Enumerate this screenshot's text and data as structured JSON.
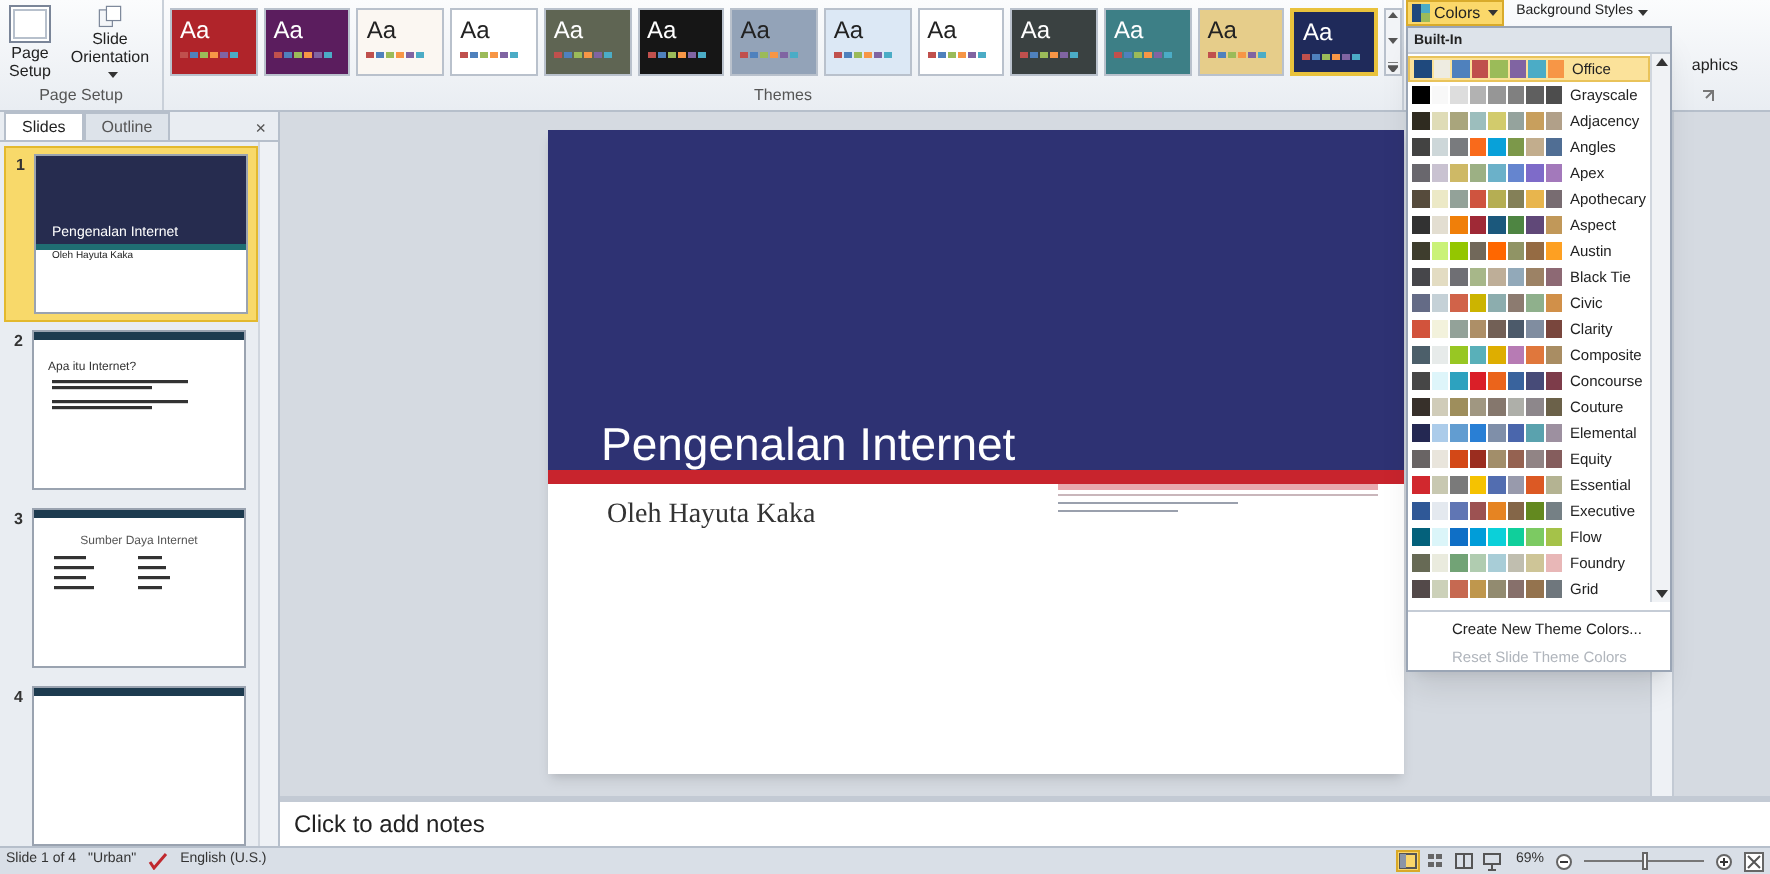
{
  "ribbon": {
    "page_setup": {
      "buttons": [
        {
          "label": "Page Setup",
          "kind": "page",
          "dropdown": false
        },
        {
          "label": "Slide Orientation",
          "kind": "orientation",
          "dropdown": true
        }
      ],
      "group_label": "Page Setup"
    },
    "themes": {
      "group_label": "Themes",
      "items": [
        {
          "text": "Aa",
          "color": "#b0242a",
          "selected": false
        },
        {
          "text": "Aa",
          "color": "#5b1d5e",
          "selected": false
        },
        {
          "text": "Aa",
          "color": "#fbf7f2",
          "selected": false
        },
        {
          "text": "Aa",
          "color": "#ffffff",
          "selected": false
        },
        {
          "text": "Aa",
          "color": "#5f6553",
          "selected": false
        },
        {
          "text": "Aa",
          "color": "#161616",
          "selected": false
        },
        {
          "text": "Aa",
          "color": "#93a3b8",
          "selected": false
        },
        {
          "text": "Aa",
          "color": "#dce8f5",
          "selected": false
        },
        {
          "text": "Aa",
          "color": "#ffffff",
          "selected": false
        },
        {
          "text": "Aa",
          "color": "#3a4141",
          "selected": false
        },
        {
          "text": "Aa",
          "color": "#3d7f86",
          "selected": false
        },
        {
          "text": "Aa",
          "color": "#e6cd8a",
          "selected": false
        },
        {
          "text": "Aa",
          "color": "#1f2a5a",
          "selected": true
        }
      ]
    },
    "colors_button": {
      "label": "Colors",
      "open": true
    },
    "background_styles": {
      "label": "Background Styles"
    },
    "hide_graphics": {
      "label": "aphics"
    }
  },
  "colors_menu": {
    "header": "Built-In",
    "schemes": [
      {
        "name": "Office",
        "selected": true,
        "swatches": [
          {
            "color": "#1f497d"
          },
          {
            "color": "#eeece1"
          },
          {
            "color": "#4f81bd"
          },
          {
            "color": "#c0504d"
          },
          {
            "color": "#9bbb59"
          },
          {
            "color": "#8064a2"
          },
          {
            "color": "#4bacc6"
          },
          {
            "color": "#f79646"
          }
        ]
      },
      {
        "name": "Grayscale",
        "selected": false,
        "swatches": [
          {
            "color": "#000000"
          },
          {
            "color": "#f8f8f8"
          },
          {
            "color": "#dddddd"
          },
          {
            "color": "#b2b2b2"
          },
          {
            "color": "#969696"
          },
          {
            "color": "#808080"
          },
          {
            "color": "#5f5f5f"
          },
          {
            "color": "#4d4d4d"
          }
        ]
      },
      {
        "name": "Adjacency",
        "selected": false,
        "swatches": [
          {
            "color": "#2f2b20"
          },
          {
            "color": "#dfdcb7"
          },
          {
            "color": "#a9a57c"
          },
          {
            "color": "#9cbebd"
          },
          {
            "color": "#d2cb6c"
          },
          {
            "color": "#95a39d"
          },
          {
            "color": "#c89f5d"
          },
          {
            "color": "#b1a089"
          }
        ]
      },
      {
        "name": "Angles",
        "selected": false,
        "swatches": [
          {
            "color": "#434342"
          },
          {
            "color": "#cdd7d9"
          },
          {
            "color": "#797b7e"
          },
          {
            "color": "#f96a1b"
          },
          {
            "color": "#08a1d9"
          },
          {
            "color": "#7c984a"
          },
          {
            "color": "#c2ad8d"
          },
          {
            "color": "#506e94"
          }
        ]
      },
      {
        "name": "Apex",
        "selected": false,
        "swatches": [
          {
            "color": "#69676d"
          },
          {
            "color": "#c9c2d1"
          },
          {
            "color": "#ceb966"
          },
          {
            "color": "#9cb084"
          },
          {
            "color": "#6bb1c9"
          },
          {
            "color": "#6585cf"
          },
          {
            "color": "#7e6bc9"
          },
          {
            "color": "#a379bb"
          }
        ]
      },
      {
        "name": "Apothecary",
        "selected": false,
        "swatches": [
          {
            "color": "#564b3c"
          },
          {
            "color": "#ece9c6"
          },
          {
            "color": "#93a299"
          },
          {
            "color": "#cf543f"
          },
          {
            "color": "#b5ae53"
          },
          {
            "color": "#848058"
          },
          {
            "color": "#e8b54d"
          },
          {
            "color": "#786c71"
          }
        ]
      },
      {
        "name": "Aspect",
        "selected": false,
        "swatches": [
          {
            "color": "#323232"
          },
          {
            "color": "#e3ded1"
          },
          {
            "color": "#f07f09"
          },
          {
            "color": "#9f2936"
          },
          {
            "color": "#1b587c"
          },
          {
            "color": "#4e8542"
          },
          {
            "color": "#604878"
          },
          {
            "color": "#c19859"
          }
        ]
      },
      {
        "name": "Austin",
        "selected": false,
        "swatches": [
          {
            "color": "#3e3d2d"
          },
          {
            "color": "#caf278"
          },
          {
            "color": "#94c600"
          },
          {
            "color": "#71685a"
          },
          {
            "color": "#ff6700"
          },
          {
            "color": "#909465"
          },
          {
            "color": "#956b43"
          },
          {
            "color": "#fea022"
          }
        ]
      },
      {
        "name": "Black Tie",
        "selected": false,
        "swatches": [
          {
            "color": "#46464a"
          },
          {
            "color": "#e3dcc2"
          },
          {
            "color": "#6f6f74"
          },
          {
            "color": "#a7b789"
          },
          {
            "color": "#beae98"
          },
          {
            "color": "#92a9b9"
          },
          {
            "color": "#9c8265"
          },
          {
            "color": "#8d6974"
          }
        ]
      },
      {
        "name": "Civic",
        "selected": false,
        "swatches": [
          {
            "color": "#646b86"
          },
          {
            "color": "#c5d1d7"
          },
          {
            "color": "#d16349"
          },
          {
            "color": "#ccb400"
          },
          {
            "color": "#8cadae"
          },
          {
            "color": "#8c7b70"
          },
          {
            "color": "#8fb08c"
          },
          {
            "color": "#d19049"
          }
        ]
      },
      {
        "name": "Clarity",
        "selected": false,
        "swatches": [
          {
            "color": "#d2533c"
          },
          {
            "color": "#f3f2dc"
          },
          {
            "color": "#93a299"
          },
          {
            "color": "#ad8f67"
          },
          {
            "color": "#726056"
          },
          {
            "color": "#4c5a6a"
          },
          {
            "color": "#808da0"
          },
          {
            "color": "#79463d"
          }
        ]
      },
      {
        "name": "Composite",
        "selected": false,
        "swatches": [
          {
            "color": "#4c5f6a"
          },
          {
            "color": "#e7ebea"
          },
          {
            "color": "#98c723"
          },
          {
            "color": "#59b0b9"
          },
          {
            "color": "#deae00"
          },
          {
            "color": "#b77bb4"
          },
          {
            "color": "#e0773c"
          },
          {
            "color": "#a98d63"
          }
        ]
      },
      {
        "name": "Concourse",
        "selected": false,
        "swatches": [
          {
            "color": "#464646"
          },
          {
            "color": "#def5fa"
          },
          {
            "color": "#2da2bf"
          },
          {
            "color": "#da1f28"
          },
          {
            "color": "#eb641b"
          },
          {
            "color": "#39639d"
          },
          {
            "color": "#474b78"
          },
          {
            "color": "#7d3c4a"
          }
        ]
      },
      {
        "name": "Couture",
        "selected": false,
        "swatches": [
          {
            "color": "#37302a"
          },
          {
            "color": "#d0ccb9"
          },
          {
            "color": "#9e8e5c"
          },
          {
            "color": "#a09781"
          },
          {
            "color": "#85776d"
          },
          {
            "color": "#aeafa9"
          },
          {
            "color": "#8d878b"
          },
          {
            "color": "#6b6149"
          }
        ]
      },
      {
        "name": "Elemental",
        "selected": false,
        "swatches": [
          {
            "color": "#242852"
          },
          {
            "color": "#acccea"
          },
          {
            "color": "#629dd1"
          },
          {
            "color": "#297fd5"
          },
          {
            "color": "#7f8fa9"
          },
          {
            "color": "#4a66ac"
          },
          {
            "color": "#5aa2ae"
          },
          {
            "color": "#9d90a0"
          }
        ]
      },
      {
        "name": "Equity",
        "selected": false,
        "swatches": [
          {
            "color": "#696464"
          },
          {
            "color": "#e9e5dc"
          },
          {
            "color": "#d34817"
          },
          {
            "color": "#9b2d1f"
          },
          {
            "color": "#a28e6a"
          },
          {
            "color": "#956251"
          },
          {
            "color": "#918485"
          },
          {
            "color": "#855d5d"
          }
        ]
      },
      {
        "name": "Essential",
        "selected": false,
        "swatches": [
          {
            "color": "#d1282e"
          },
          {
            "color": "#c8c8b1"
          },
          {
            "color": "#7a7a7a"
          },
          {
            "color": "#f5c201"
          },
          {
            "color": "#526db0"
          },
          {
            "color": "#989aac"
          },
          {
            "color": "#dc5924"
          },
          {
            "color": "#b4b392"
          }
        ]
      },
      {
        "name": "Executive",
        "selected": false,
        "swatches": [
          {
            "color": "#2f5897"
          },
          {
            "color": "#e4e9ef"
          },
          {
            "color": "#6076b4"
          },
          {
            "color": "#9c5252"
          },
          {
            "color": "#e68422"
          },
          {
            "color": "#846648"
          },
          {
            "color": "#63891f"
          },
          {
            "color": "#758085"
          }
        ]
      },
      {
        "name": "Flow",
        "selected": false,
        "swatches": [
          {
            "color": "#04617b"
          },
          {
            "color": "#dbf5f9"
          },
          {
            "color": "#0f6fc6"
          },
          {
            "color": "#009dd9"
          },
          {
            "color": "#0bd0d9"
          },
          {
            "color": "#10cf9b"
          },
          {
            "color": "#7cca62"
          },
          {
            "color": "#a5c249"
          }
        ]
      },
      {
        "name": "Foundry",
        "selected": false,
        "swatches": [
          {
            "color": "#676a55"
          },
          {
            "color": "#eaebde"
          },
          {
            "color": "#72a376"
          },
          {
            "color": "#b0ccb0"
          },
          {
            "color": "#a8cdd7"
          },
          {
            "color": "#c0beaf"
          },
          {
            "color": "#cec597"
          },
          {
            "color": "#e8b7b7"
          }
        ]
      },
      {
        "name": "Grid",
        "selected": false,
        "swatches": [
          {
            "color": "#534949"
          },
          {
            "color": "#ccd1b9"
          },
          {
            "color": "#c66951"
          },
          {
            "color": "#bf974d"
          },
          {
            "color": "#928b70"
          },
          {
            "color": "#87706b"
          },
          {
            "color": "#94734e"
          },
          {
            "color": "#6f777d"
          }
        ]
      }
    ],
    "actions": [
      {
        "label": "Create New Theme Colors...",
        "disabled": false
      },
      {
        "label": "Reset Slide Theme Colors",
        "disabled": true
      }
    ]
  },
  "slides_pane": {
    "tabs": [
      {
        "label": "Slides",
        "selected": true
      },
      {
        "label": "Outline",
        "selected": false
      }
    ],
    "close": "×",
    "slides": [
      {
        "number": "1",
        "kind": "title",
        "selected": true,
        "title": "Pengenalan Internet",
        "subtitle": "Oleh Hayuta Kaka"
      },
      {
        "number": "2",
        "kind": "bullets",
        "selected": false,
        "title": "Apa itu Internet?"
      },
      {
        "number": "3",
        "kind": "columns",
        "selected": false,
        "title": "Sumber Daya Internet"
      },
      {
        "number": "4",
        "kind": "blank",
        "selected": false
      }
    ]
  },
  "slide": {
    "title": "Pengenalan Internet",
    "subtitle": "Oleh Hayuta Kaka"
  },
  "notes": {
    "placeholder": "Click to add notes"
  },
  "status_bar": {
    "slide_info": "Slide 1 of 4",
    "theme": "\"Urban\"",
    "language": "English (U.S.)",
    "views": [
      {
        "kind": "normal",
        "selected": true
      },
      {
        "kind": "sorter",
        "selected": false
      },
      {
        "kind": "reading",
        "selected": false
      },
      {
        "kind": "slideshow",
        "selected": false
      }
    ],
    "zoom": "69%",
    "zoom_slider": {
      "level": 0.5
    }
  }
}
